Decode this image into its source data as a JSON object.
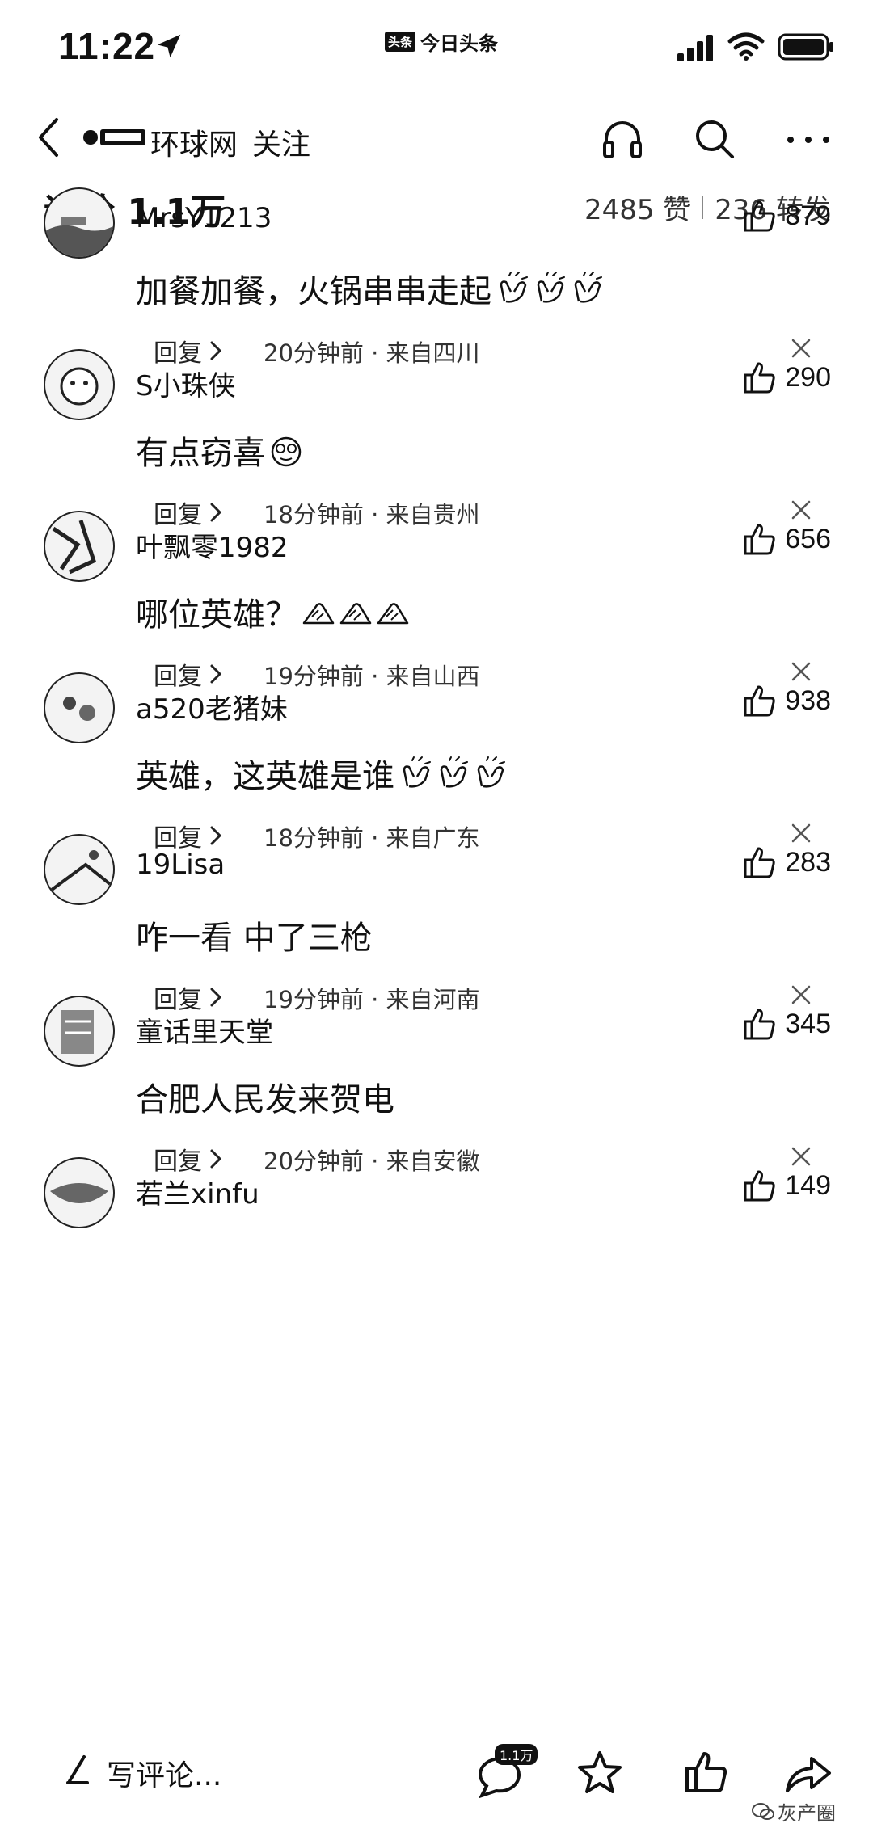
{
  "status_bar": {
    "time": "11:22",
    "app_name": "今日头条",
    "app_badge": "头条"
  },
  "nav": {
    "account_name": "环球网",
    "follow_label": "关注"
  },
  "comments_header": {
    "title": "评论 1.1万",
    "likes": "2485 赞",
    "shares": "236 转发"
  },
  "comments": [
    {
      "username": "MrsY1213",
      "likes": "879",
      "text": "加餐加餐，火锅串串走起",
      "emoji": "clapping-hands",
      "emoji_count": 3,
      "reply_label": "回复",
      "meta": "20分钟前 · 来自四川"
    },
    {
      "username": "S小珠侠",
      "likes": "290",
      "text": "有点窃喜",
      "emoji": "dizzy-face",
      "emoji_count": 1,
      "reply_label": "回复",
      "meta": "18分钟前 · 来自贵州"
    },
    {
      "username": "叶飘零1982",
      "likes": "656",
      "text": "哪位英雄？",
      "emoji": "fist-salute",
      "emoji_count": 3,
      "reply_label": "回复",
      "meta": "19分钟前 · 来自山西"
    },
    {
      "username": "a520老猪妹",
      "likes": "938",
      "text": "英雄，这英雄是谁",
      "emoji": "clapping-hands",
      "emoji_count": 3,
      "reply_label": "回复",
      "meta": "18分钟前 · 来自广东"
    },
    {
      "username": "19Lisa",
      "likes": "283",
      "text": "咋一看 中了三枪",
      "emoji": "",
      "emoji_count": 0,
      "reply_label": "回复",
      "meta": "19分钟前 · 来自河南"
    },
    {
      "username": "童话里天堂",
      "likes": "345",
      "text": "合肥人民发来贺电",
      "emoji": "",
      "emoji_count": 0,
      "reply_label": "回复",
      "meta": "20分钟前 · 来自安徽"
    },
    {
      "username": "若兰xinfu",
      "likes": "149",
      "text": "",
      "emoji": "",
      "emoji_count": 0,
      "reply_label": "",
      "meta": ""
    }
  ],
  "bottom_bar": {
    "write_placeholder": "写评论...",
    "comment_badge": "1.1万",
    "watermark": "灰产圈"
  },
  "colors": {
    "text": "#111111",
    "secondary_text": "#333333",
    "background": "#ffffff"
  }
}
